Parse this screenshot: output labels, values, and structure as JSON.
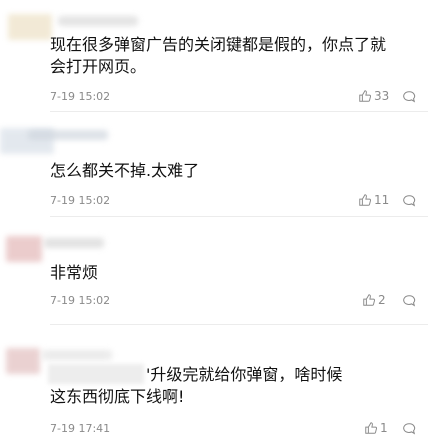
{
  "comments": [
    {
      "lines": [
        "现在很多弹窗广告的关闭键都是假的，你点了就",
        "会打开网页。"
      ],
      "time": "7-19 15:02",
      "likes": "33",
      "avatar_color": "#f2ead9"
    },
    {
      "lines": [
        "怎么都关不掉.太难了"
      ],
      "time": "7-19 15:02",
      "likes": "11",
      "avatar_color": "#dde3ea"
    },
    {
      "lines": [
        "非常烦"
      ],
      "time": "7-19 15:02",
      "likes": "2",
      "avatar_color": "#e9c9c9"
    },
    {
      "lines": [
        "'升级完就给你弹窗，啥时候",
        "这东西彻底下线啊!"
      ],
      "time": "7-19 17:41",
      "likes": "1",
      "avatar_color": "#e6cfcf"
    }
  ],
  "icons": {
    "like": "thumbs-up-icon",
    "reply": "comment-bubble-icon"
  }
}
